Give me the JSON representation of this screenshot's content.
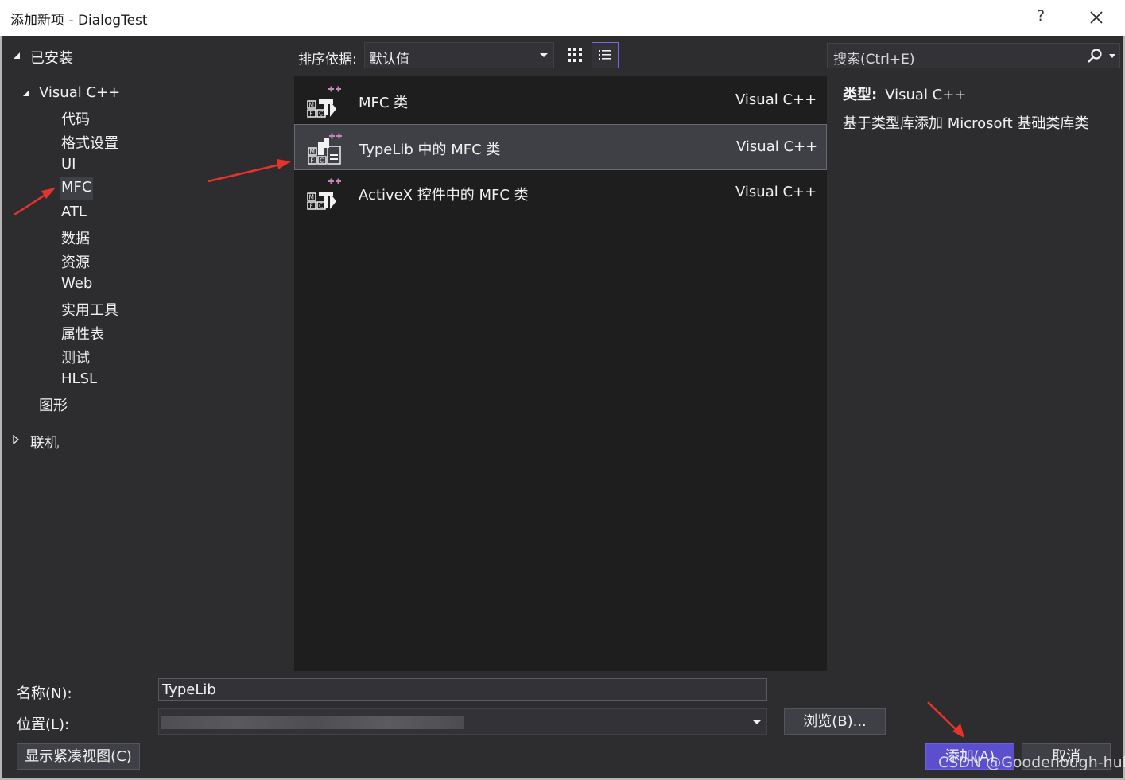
{
  "window": {
    "title": "添加新项 - DialogTest",
    "help": "?"
  },
  "tree": {
    "installed": "已安装",
    "visual_cpp": "Visual C++",
    "children": [
      "代码",
      "格式设置",
      "UI",
      "MFC",
      "ATL",
      "数据",
      "资源",
      "Web",
      "实用工具",
      "属性表",
      "测试",
      "HLSL"
    ],
    "selected": "MFC",
    "graphics": "图形",
    "online": "联机"
  },
  "toolbar": {
    "sort_label": "排序依据:",
    "sort_value": "默认值",
    "search_placeholder": "搜索(Ctrl+E)",
    "active_view": "list"
  },
  "items": [
    {
      "name": "MFC 类",
      "lang": "Visual C++"
    },
    {
      "name": "TypeLib 中的 MFC 类",
      "lang": "Visual C++",
      "selected": true
    },
    {
      "name": "ActiveX 控件中的 MFC 类",
      "lang": "Visual C++"
    }
  ],
  "details": {
    "type_label": "类型:",
    "type_value": "Visual C++",
    "description": "基于类型库添加 Microsoft 基础类库类"
  },
  "form": {
    "name_label": "名称(N):",
    "name_value": "TypeLib",
    "location_label": "位置(L):",
    "browse": "浏览(B)...",
    "compact_view": "显示紧凑视图(C)",
    "add": "添加(A)",
    "cancel": "取消"
  },
  "watermark": "CSDN @Goodenough-hub",
  "colors": {
    "accent": "#5b4fce",
    "annotation_arrow": "#e8322c",
    "list_background": "#1e1e1e",
    "panel_background": "#2d2d30"
  }
}
